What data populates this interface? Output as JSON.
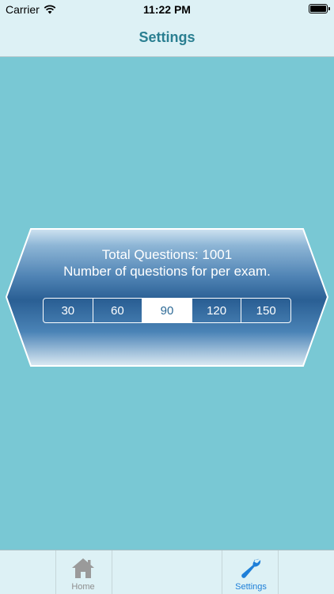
{
  "status_bar": {
    "carrier": "Carrier",
    "time": "11:22 PM"
  },
  "nav": {
    "title": "Settings"
  },
  "panel": {
    "total_questions": "Total Questions: 1001",
    "subtitle": "Number of questions for per exam.",
    "options": [
      "30",
      "60",
      "90",
      "120",
      "150"
    ],
    "selected": "90"
  },
  "tabs": [
    {
      "label": "Home",
      "icon": "house-icon",
      "active": false
    },
    {
      "label": "Settings",
      "icon": "wrench-icon",
      "active": true
    }
  ],
  "colors": {
    "background": "#79c8d4",
    "bar": "#ddf1f5",
    "title": "#2a7f91",
    "panel_dark": "#2a5f94",
    "active_tab": "#1e7fd8"
  }
}
